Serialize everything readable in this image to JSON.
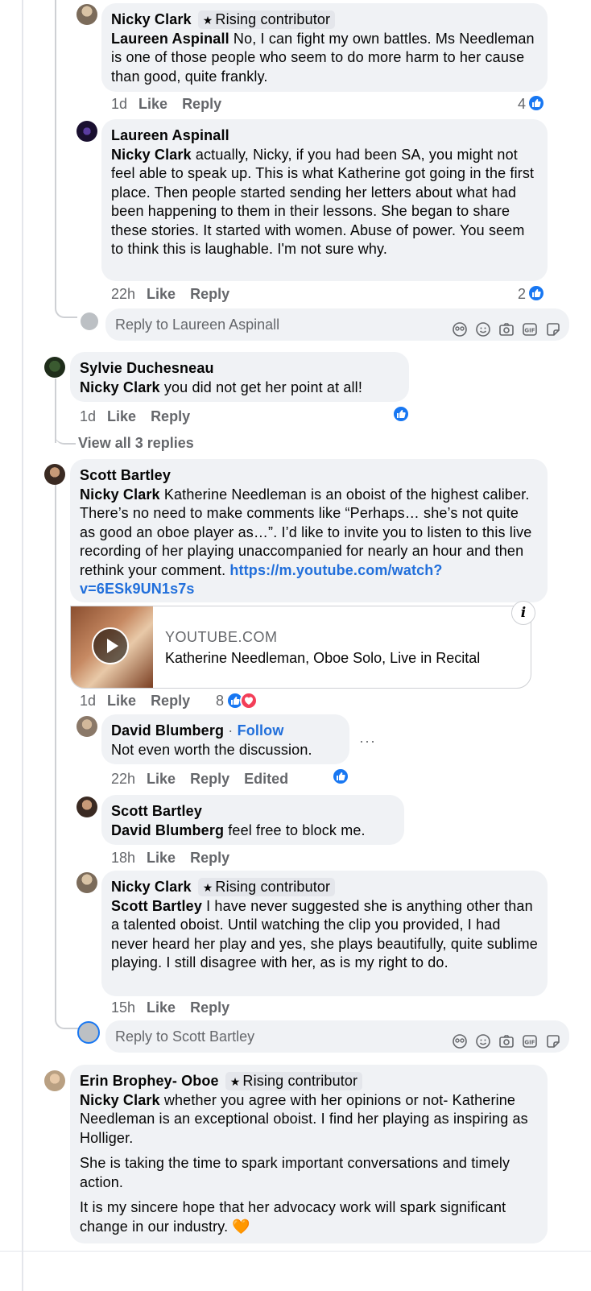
{
  "comments": {
    "c1": {
      "author": "Nicky Clark",
      "badge": "Rising contributor",
      "tag": "Laureen Aspinall",
      "text": " No, I can fight my own battles. Ms Needleman is one of those people who seem to do more harm to her cause than good, quite frankly.",
      "time": "1d",
      "like": "Like",
      "reply": "Reply",
      "reactions": "4"
    },
    "c2": {
      "author": "Laureen Aspinall",
      "tag": "Nicky Clark",
      "text": " actually, Nicky, if you had been SA, you might not feel able to speak up. This is what Katherine got going in the first place. Then people started sending her letters about what had been happening to them in their lessons. She began to share these stories. It started with women. Abuse of power. You seem to think this is laughable. I'm not sure why.",
      "time": "22h",
      "like": "Like",
      "reply": "Reply",
      "reactions": "2"
    },
    "reply_box_1": {
      "placeholder": "Reply to Laureen Aspinall"
    },
    "c3": {
      "author": "Sylvie Duchesneau",
      "tag": "Nicky Clark",
      "text": " you did not get her point at all!",
      "time": "1d",
      "like": "Like",
      "reply": "Reply",
      "view_all": "View all 3 replies"
    },
    "c4": {
      "author": "Scott Bartley",
      "tag": "Nicky Clark",
      "text": " Katherine Needleman is an oboist of the highest caliber. There’s no need to make comments like “Perhaps… she’s not quite as good an oboe player as…”. I’d like to invite you to listen to this live recording of her playing unaccompanied for nearly an hour and then rethink your comment. ",
      "link": "https://m.youtube.com/watch?v=6ESk9UN1s7s",
      "card_domain": "YOUTUBE.COM",
      "card_title": "Katherine Needleman, Oboe Solo, Live in Recital",
      "time": "1d",
      "like": "Like",
      "reply": "Reply",
      "reactions": "8"
    },
    "c5": {
      "author": "David Blumberg",
      "follow_sep": " · ",
      "follow": "Follow",
      "text": "Not even worth the discussion.",
      "time": "22h",
      "like": "Like",
      "reply": "Reply",
      "edited": "Edited",
      "more": "···"
    },
    "c6": {
      "author": "Scott Bartley",
      "tag": "David Blumberg",
      "text": " feel free to block me.",
      "time": "18h",
      "like": "Like",
      "reply": "Reply"
    },
    "c7": {
      "author": "Nicky Clark",
      "badge": "Rising contributor",
      "tag": "Scott Bartley",
      "text": " I have never suggested she is anything other than a talented oboist. Until watching the clip you provided, I had never heard her play and yes, she plays beautifully, quite sublime playing. I still disagree with her, as is my right to do.",
      "time": "15h",
      "like": "Like",
      "reply": "Reply"
    },
    "reply_box_2": {
      "placeholder": "Reply to Scott Bartley"
    },
    "c8": {
      "author": "Erin Brophey- Oboe",
      "badge": "Rising contributor",
      "tag": "Nicky Clark",
      "text": " whether you agree with her opinions or not- Katherine Needleman is an exceptional oboist. I find her playing as inspiring as Holliger.",
      "para2": "She is taking the time to spark important conversations and timely action.",
      "para3": "It is my sincere hope that her advocacy work will spark significant change in our industry. 🧡"
    }
  },
  "icons": [
    "like-icon",
    "love-icon",
    "sticker-icon",
    "emoji-icon",
    "camera-icon",
    "gif-icon",
    "avatar-sticker-icon",
    "play-icon",
    "info-icon"
  ],
  "colors": {
    "like_blue": "#1877f2",
    "love_red": "#f33e58",
    "link_blue": "#216fdb",
    "bubble": "#f0f2f5",
    "meta_gray": "#65676b"
  }
}
